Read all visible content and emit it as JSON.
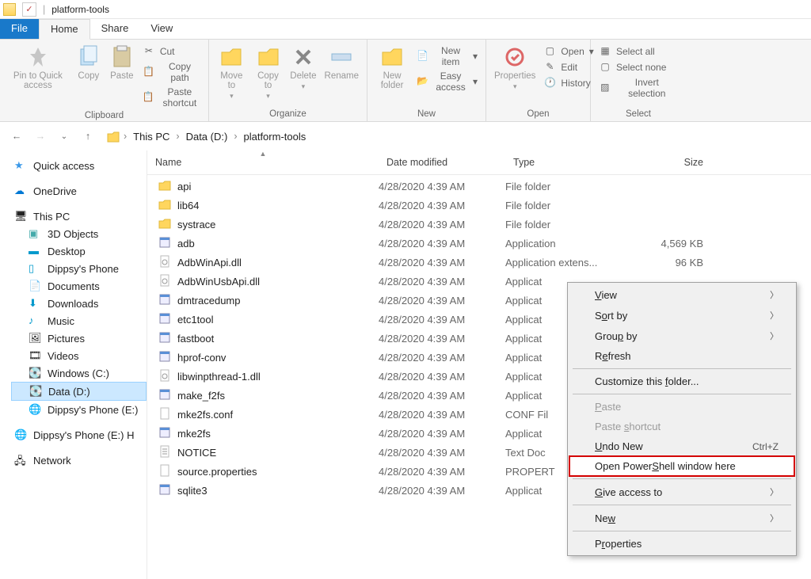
{
  "window": {
    "title": "platform-tools"
  },
  "tabs": {
    "file": "File",
    "home": "Home",
    "share": "Share",
    "view": "View"
  },
  "ribbon": {
    "clipboard": {
      "label": "Clipboard",
      "pin": "Pin to Quick access",
      "copy": "Copy",
      "paste": "Paste",
      "cut": "Cut",
      "copypath": "Copy path",
      "pasteshortcut": "Paste shortcut"
    },
    "organize": {
      "label": "Organize",
      "moveto": "Move to",
      "copyto": "Copy to",
      "delete": "Delete",
      "rename": "Rename"
    },
    "new": {
      "label": "New",
      "newfolder": "New folder",
      "newitem": "New item",
      "easyaccess": "Easy access"
    },
    "open": {
      "label": "Open",
      "properties": "Properties",
      "open": "Open",
      "edit": "Edit",
      "history": "History"
    },
    "select": {
      "label": "Select",
      "all": "Select all",
      "none": "Select none",
      "invert": "Invert selection"
    }
  },
  "breadcrumbs": [
    "This PC",
    "Data (D:)",
    "platform-tools"
  ],
  "columns": {
    "name": "Name",
    "date": "Date modified",
    "type": "Type",
    "size": "Size"
  },
  "sidebar": {
    "quick": "Quick access",
    "onedrive": "OneDrive",
    "thispc": "This PC",
    "threed": "3D Objects",
    "desktop": "Desktop",
    "phone1": "Dippsy's Phone",
    "documents": "Documents",
    "downloads": "Downloads",
    "music": "Music",
    "pictures": "Pictures",
    "videos": "Videos",
    "c": "Windows (C:)",
    "d": "Data (D:)",
    "e": "Dippsy's Phone (E:)",
    "phone2": "Dippsy's Phone (E:) H",
    "network": "Network"
  },
  "files": [
    {
      "icon": "folder",
      "name": "api",
      "date": "4/28/2020 4:39 AM",
      "type": "File folder",
      "size": ""
    },
    {
      "icon": "folder",
      "name": "lib64",
      "date": "4/28/2020 4:39 AM",
      "type": "File folder",
      "size": ""
    },
    {
      "icon": "folder",
      "name": "systrace",
      "date": "4/28/2020 4:39 AM",
      "type": "File folder",
      "size": ""
    },
    {
      "icon": "exe",
      "name": "adb",
      "date": "4/28/2020 4:39 AM",
      "type": "Application",
      "size": "4,569 KB"
    },
    {
      "icon": "dll",
      "name": "AdbWinApi.dll",
      "date": "4/28/2020 4:39 AM",
      "type": "Application extens...",
      "size": "96 KB"
    },
    {
      "icon": "dll",
      "name": "AdbWinUsbApi.dll",
      "date": "4/28/2020 4:39 AM",
      "type": "Applicat",
      "size": ""
    },
    {
      "icon": "exe",
      "name": "dmtracedump",
      "date": "4/28/2020 4:39 AM",
      "type": "Applicat",
      "size": ""
    },
    {
      "icon": "exe",
      "name": "etc1tool",
      "date": "4/28/2020 4:39 AM",
      "type": "Applicat",
      "size": ""
    },
    {
      "icon": "exe",
      "name": "fastboot",
      "date": "4/28/2020 4:39 AM",
      "type": "Applicat",
      "size": ""
    },
    {
      "icon": "exe",
      "name": "hprof-conv",
      "date": "4/28/2020 4:39 AM",
      "type": "Applicat",
      "size": ""
    },
    {
      "icon": "dll",
      "name": "libwinpthread-1.dll",
      "date": "4/28/2020 4:39 AM",
      "type": "Applicat",
      "size": ""
    },
    {
      "icon": "exe",
      "name": "make_f2fs",
      "date": "4/28/2020 4:39 AM",
      "type": "Applicat",
      "size": ""
    },
    {
      "icon": "conf",
      "name": "mke2fs.conf",
      "date": "4/28/2020 4:39 AM",
      "type": "CONF Fil",
      "size": ""
    },
    {
      "icon": "exe",
      "name": "mke2fs",
      "date": "4/28/2020 4:39 AM",
      "type": "Applicat",
      "size": ""
    },
    {
      "icon": "txt",
      "name": "NOTICE",
      "date": "4/28/2020 4:39 AM",
      "type": "Text Doc",
      "size": ""
    },
    {
      "icon": "conf",
      "name": "source.properties",
      "date": "4/28/2020 4:39 AM",
      "type": "PROPERT",
      "size": ""
    },
    {
      "icon": "exe",
      "name": "sqlite3",
      "date": "4/28/2020 4:39 AM",
      "type": "Applicat",
      "size": ""
    }
  ],
  "context": {
    "view": "View",
    "sortby": "Sort by",
    "groupby": "Group by",
    "refresh": "Refresh",
    "customize": "Customize this folder...",
    "paste": "Paste",
    "pasteshortcut": "Paste shortcut",
    "undonew": "Undo New",
    "undonew_sc": "Ctrl+Z",
    "powershell": "Open PowerShell window here",
    "giveaccess": "Give access to",
    "new": "New",
    "properties": "Properties"
  }
}
